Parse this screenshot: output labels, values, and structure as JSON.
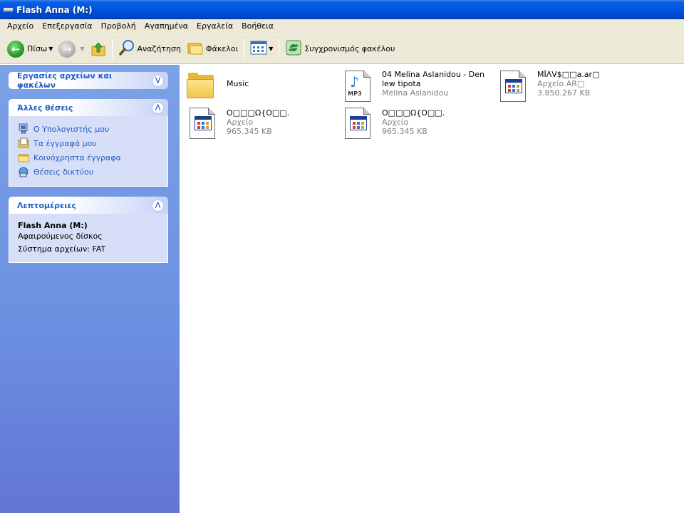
{
  "window": {
    "title": "Flash Anna (M:)"
  },
  "menubar": [
    "Αρχείο",
    "Επεξεργασία",
    "Προβολή",
    "Αγαπημένα",
    "Εργαλεία",
    "Βοήθεια"
  ],
  "toolbar": {
    "back_label": "Πίσω",
    "search_label": "Αναζήτηση",
    "folders_label": "Φάκελοι",
    "sync_label": "Συγχρονισμός φακέλου"
  },
  "taskpane": {
    "file_tasks": {
      "title": "Εργασίες αρχείων και φακέλων",
      "collapsed": true
    },
    "other_places": {
      "title": "Άλλες θέσεις",
      "items": [
        "Ο Υπολογιστής μου",
        "Τα έγγραφά μου",
        "Κοινόχρηστα έγγραφα",
        "Θέσεις δικτύου"
      ]
    },
    "details": {
      "title": "Λεπτομέρειες",
      "name": "Flash Anna (M:)",
      "type": "Αφαιρούμενος δίσκος",
      "filesystem": "Σύστημα αρχείων: FAT"
    }
  },
  "files": [
    {
      "icon": "folder-icon",
      "name": "Music",
      "type": "",
      "size": ""
    },
    {
      "icon": "mp3-file-icon",
      "name": "04 Melina Aslanidou - Den lew tipota",
      "type": "Melina Aslanidou",
      "size": ""
    },
    {
      "icon": "executable-file-icon",
      "name": "MΪΛV$□□a.ar□",
      "type": "Αρχείο AR□",
      "size": "3.850.267 KB"
    },
    {
      "icon": "executable-file-icon",
      "name": "O□□□Ω{O□□.",
      "type": "Αρχείο",
      "size": "965.345 KB"
    },
    {
      "icon": "executable-file-icon",
      "name": "O□□□Ω{O□□.",
      "type": "Αρχείο",
      "size": "965.345 KB"
    }
  ],
  "colors": {
    "title_bar": "#0055e5",
    "task_pane": "#6b8fe0",
    "panel_title": "#215dc6",
    "chrome": "#ece9d8"
  }
}
